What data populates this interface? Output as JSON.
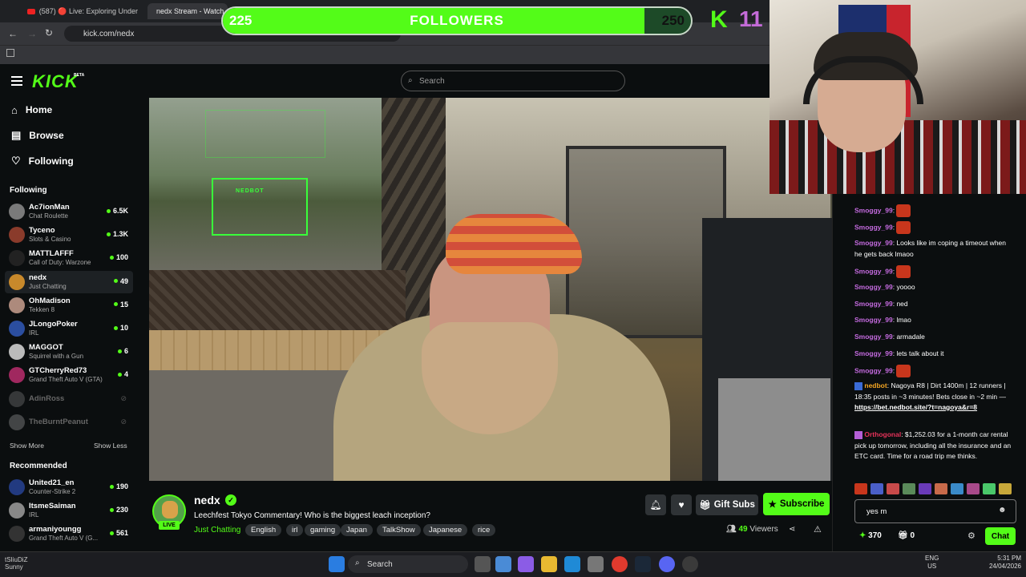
{
  "browser": {
    "tabs": [
      {
        "label": "(587) 🔴 Live: Exploring Under",
        "active": false
      },
      {
        "label": "nedx Stream - Watch",
        "active": true
      }
    ],
    "url": "kick.com/nedx"
  },
  "overlay": {
    "followers_current": "225",
    "followers_label": "FOLLOWERS",
    "followers_goal": "250",
    "followers_progress": 0.9,
    "badge_letter": "K",
    "badge_count": "11"
  },
  "header": {
    "logo": "KICK",
    "beta": "BETA",
    "search_placeholder": "Search"
  },
  "sidebar": {
    "nav": [
      {
        "label": "Home",
        "icon": "home-icon"
      },
      {
        "label": "Browse",
        "icon": "browse-icon"
      },
      {
        "label": "Following",
        "icon": "heart-icon"
      }
    ],
    "following_title": "Following",
    "following": [
      {
        "name": "Ac7ionMan",
        "game": "Chat Roulette",
        "viewers": "6.5K",
        "live": true,
        "color": "#7a7a7a"
      },
      {
        "name": "Tyceno",
        "game": "Slots & Casino",
        "viewers": "1.3K",
        "live": true,
        "color": "#8a3b2b"
      },
      {
        "name": "MATTLAFFF",
        "game": "Call of Duty: Warzone",
        "viewers": "100",
        "live": true,
        "color": "#222"
      },
      {
        "name": "nedx",
        "game": "Just Chatting",
        "viewers": "49",
        "live": true,
        "color": "#c8892b",
        "selected": true
      },
      {
        "name": "OhMadison",
        "game": "Tekken 8",
        "viewers": "15",
        "live": true,
        "color": "#ad8a7c"
      },
      {
        "name": "JLongoPoker",
        "game": "IRL",
        "viewers": "10",
        "live": true,
        "color": "#2b4ea0"
      },
      {
        "name": "MAGGOT",
        "game": "Squirrel with a Gun",
        "viewers": "6",
        "live": true,
        "color": "#bbb"
      },
      {
        "name": "GTCherryRed73",
        "game": "Grand Theft Auto V (GTA)",
        "viewers": "4",
        "live": true,
        "color": "#a0285f"
      },
      {
        "name": "AdinRoss",
        "game": "",
        "viewers": "",
        "live": false,
        "color": "#777"
      },
      {
        "name": "TheBurntPeanut",
        "game": "",
        "viewers": "",
        "live": false,
        "color": "#999"
      }
    ],
    "show_more": "Show More",
    "show_less": "Show Less",
    "recommended_title": "Recommended",
    "recommended": [
      {
        "name": "United21_en",
        "game": "Counter-Strike 2",
        "viewers": "190",
        "color": "#223a80"
      },
      {
        "name": "ItsmeSaiman",
        "game": "IRL",
        "viewers": "230",
        "color": "#888"
      },
      {
        "name": "armaniyoungg",
        "game": "Grand Theft Auto V (G...",
        "viewers": "561",
        "color": "#333"
      }
    ]
  },
  "video": {
    "hud_label": "NEDBOT"
  },
  "stream": {
    "name": "nedx",
    "live_badge": "LIVE",
    "title": "Leechfest Tokyo Commentary! Who is the biggest leach inception?",
    "category": "Just Chatting",
    "tags": [
      "English",
      "irl",
      "gaming",
      "Japan",
      "TalkShow",
      "Japanese",
      "rice"
    ],
    "gift_label": "Gift Subs",
    "subscribe_label": "Subscribe",
    "viewers": "49",
    "viewers_label": "Viewers"
  },
  "chat": {
    "messages": [
      {
        "user": "Smoggy_99",
        "text": "",
        "emote": true
      },
      {
        "user": "Smoggy_99",
        "text": "",
        "emote": true
      },
      {
        "user": "Smoggy_99",
        "text": "Looks like im coping a timeout when he gets back lmaoo",
        "emote": false
      },
      {
        "user": "Smoggy_99",
        "text": "",
        "emote": true
      },
      {
        "user": "Smoggy_99",
        "text": "yoooo",
        "emote": false
      },
      {
        "user": "Smoggy_99",
        "text": "ned",
        "emote": false
      },
      {
        "user": "Smoggy_99",
        "text": "lmao",
        "emote": false
      },
      {
        "user": "Smoggy_99",
        "text": "armadale",
        "emote": false
      },
      {
        "user": "Smoggy_99",
        "text": "lets talk about it",
        "emote": false
      },
      {
        "user": "Smoggy_99",
        "text": "",
        "emote": true
      }
    ],
    "nedbot": {
      "user": "nedbot",
      "text": "Nagoya R8 | Dirt 1400m | 12 runners | 18:35 posts in ~3 minutes! Bets close in ~2 min —",
      "link": "https://bet.nedbot.site/?t=nagoya&r=8"
    },
    "ortho": {
      "user": "Orthogonal",
      "text": "$1,252.03 for a 1-month car rental pick up tomorrow, including all the insurance and an ETC card. Time for a road trip me thinks."
    },
    "input_value": "yes m",
    "points": "370",
    "gifts": "0",
    "send_label": "Chat"
  },
  "taskbar": {
    "search": "Search",
    "lang": "ENG",
    "region": "US",
    "time": "5:31 PM",
    "date": "24/04/2026",
    "weather_line1": "tSIiuDiZ",
    "weather_line2": "Sunny"
  }
}
